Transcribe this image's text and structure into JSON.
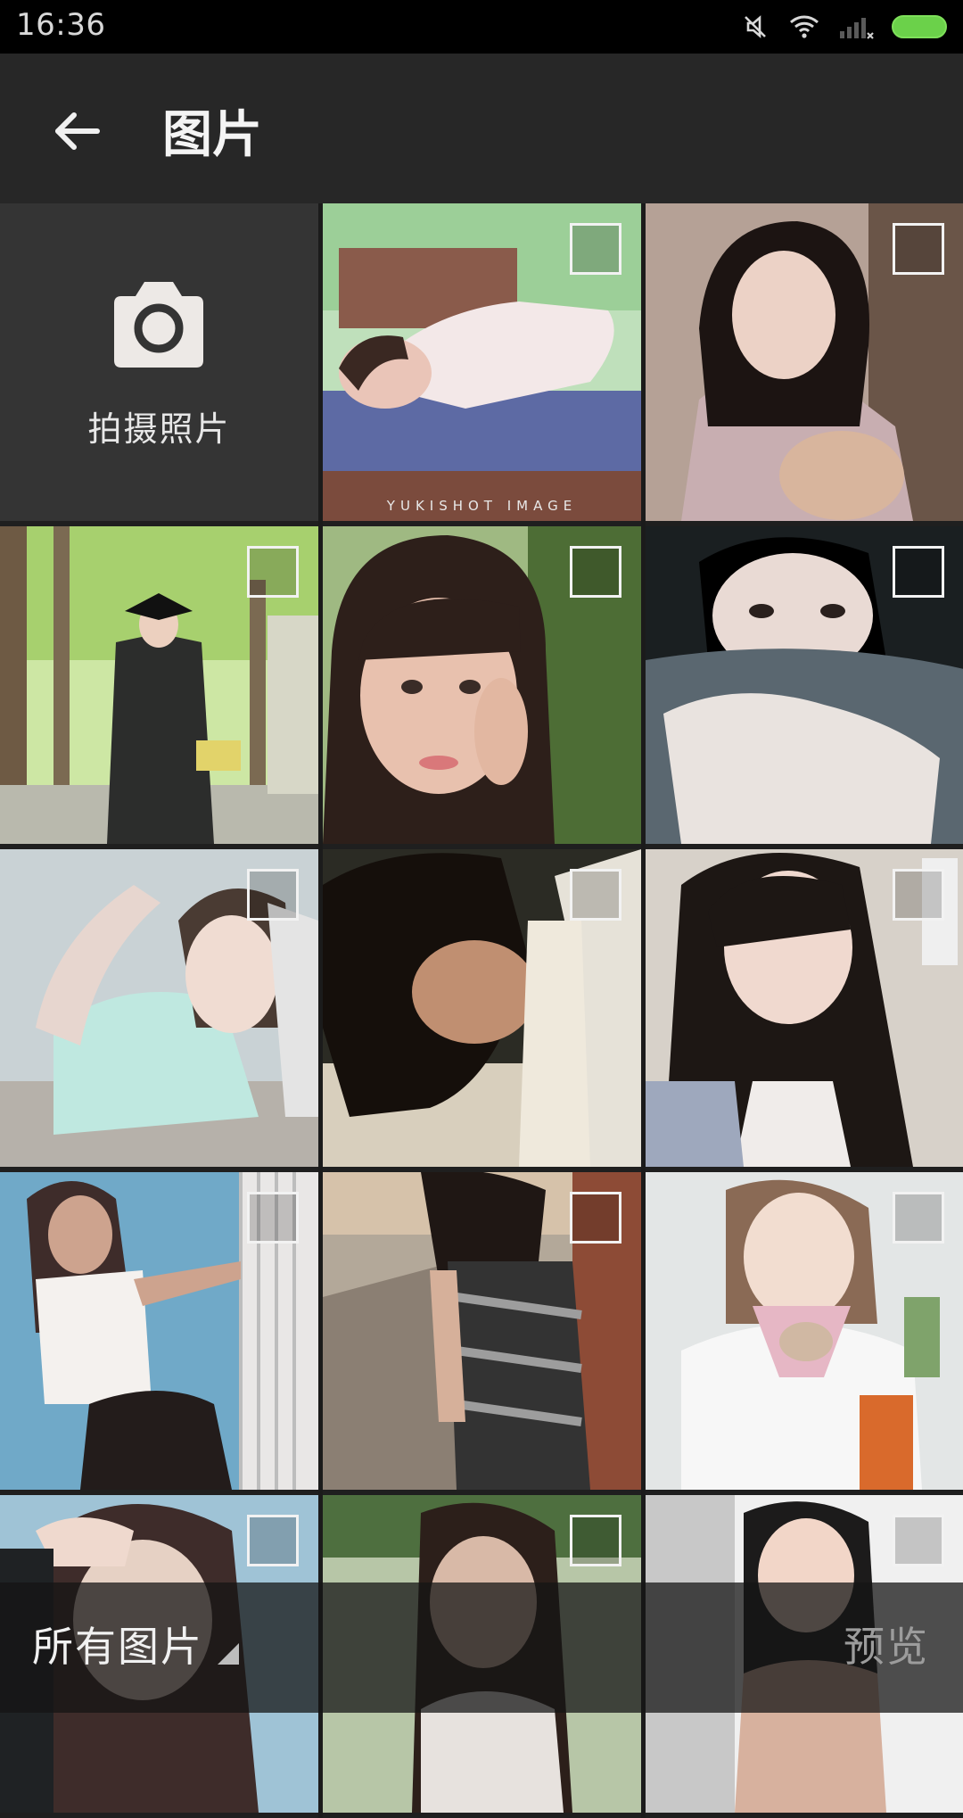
{
  "status_bar": {
    "time": "16:36",
    "icons": [
      "mute-icon",
      "wifi-icon",
      "signal-icon",
      "battery-icon"
    ]
  },
  "header": {
    "back_icon": "arrow-left-icon",
    "title": "图片"
  },
  "grid": {
    "camera_tile": {
      "icon": "camera-icon",
      "label": "拍摄照片"
    },
    "photos": [
      {
        "id": "p1",
        "watermark": "YUKISHOT IMAGE",
        "colors": [
          "#9ccf98",
          "#5d6aa4",
          "#f3e8e8",
          "#7b4b3d"
        ]
      },
      {
        "id": "p2",
        "colors": [
          "#3a2a22",
          "#c8aeb1",
          "#d8d3cf",
          "#1c1412"
        ]
      },
      {
        "id": "p3",
        "colors": [
          "#a7d06e",
          "#2c2d2c",
          "#d7d7c7",
          "#6e8e49"
        ]
      },
      {
        "id": "p4",
        "colors": [
          "#4d6d35",
          "#e2b7a1",
          "#2d1f1a",
          "#9fb982"
        ]
      },
      {
        "id": "p5",
        "colors": [
          "#1a1f21",
          "#e9e3df",
          "#5a6770",
          "#000000"
        ]
      },
      {
        "id": "p6",
        "colors": [
          "#c9d2d5",
          "#bfe8e0",
          "#e7d6cf",
          "#4a3b33"
        ]
      },
      {
        "id": "p7",
        "colors": [
          "#2b2b24",
          "#c08f71",
          "#e6e2d8",
          "#150f0b"
        ]
      },
      {
        "id": "p8",
        "colors": [
          "#d7d1c9",
          "#1d1714",
          "#9ea8bd",
          "#f0ecea"
        ]
      },
      {
        "id": "p9",
        "colors": [
          "#70a9c8",
          "#e9e7e6",
          "#231c1b",
          "#cda38e"
        ]
      },
      {
        "id": "p10",
        "colors": [
          "#8b7f73",
          "#333333",
          "#d6c2aa",
          "#8d4b36"
        ]
      },
      {
        "id": "p11",
        "colors": [
          "#e3e6e6",
          "#d0b8a3",
          "#f2f2f2",
          "#d96a2c"
        ]
      },
      {
        "id": "p12",
        "colors": [
          "#9fc3d6",
          "#3e2c2a",
          "#e6d1c4",
          "#1f2224"
        ]
      },
      {
        "id": "p13",
        "colors": [
          "#4e6f3f",
          "#2c1f1a",
          "#d8b9a7",
          "#e7e2de"
        ]
      },
      {
        "id": "p14",
        "colors": [
          "#f0f0f0",
          "#d7b19e",
          "#1c1b1b",
          "#c8c8c8"
        ]
      }
    ]
  },
  "bottom_bar": {
    "folder_label": "所有图片",
    "folder_caret_icon": "triangle-down-right-icon",
    "preview_label": "预览"
  }
}
